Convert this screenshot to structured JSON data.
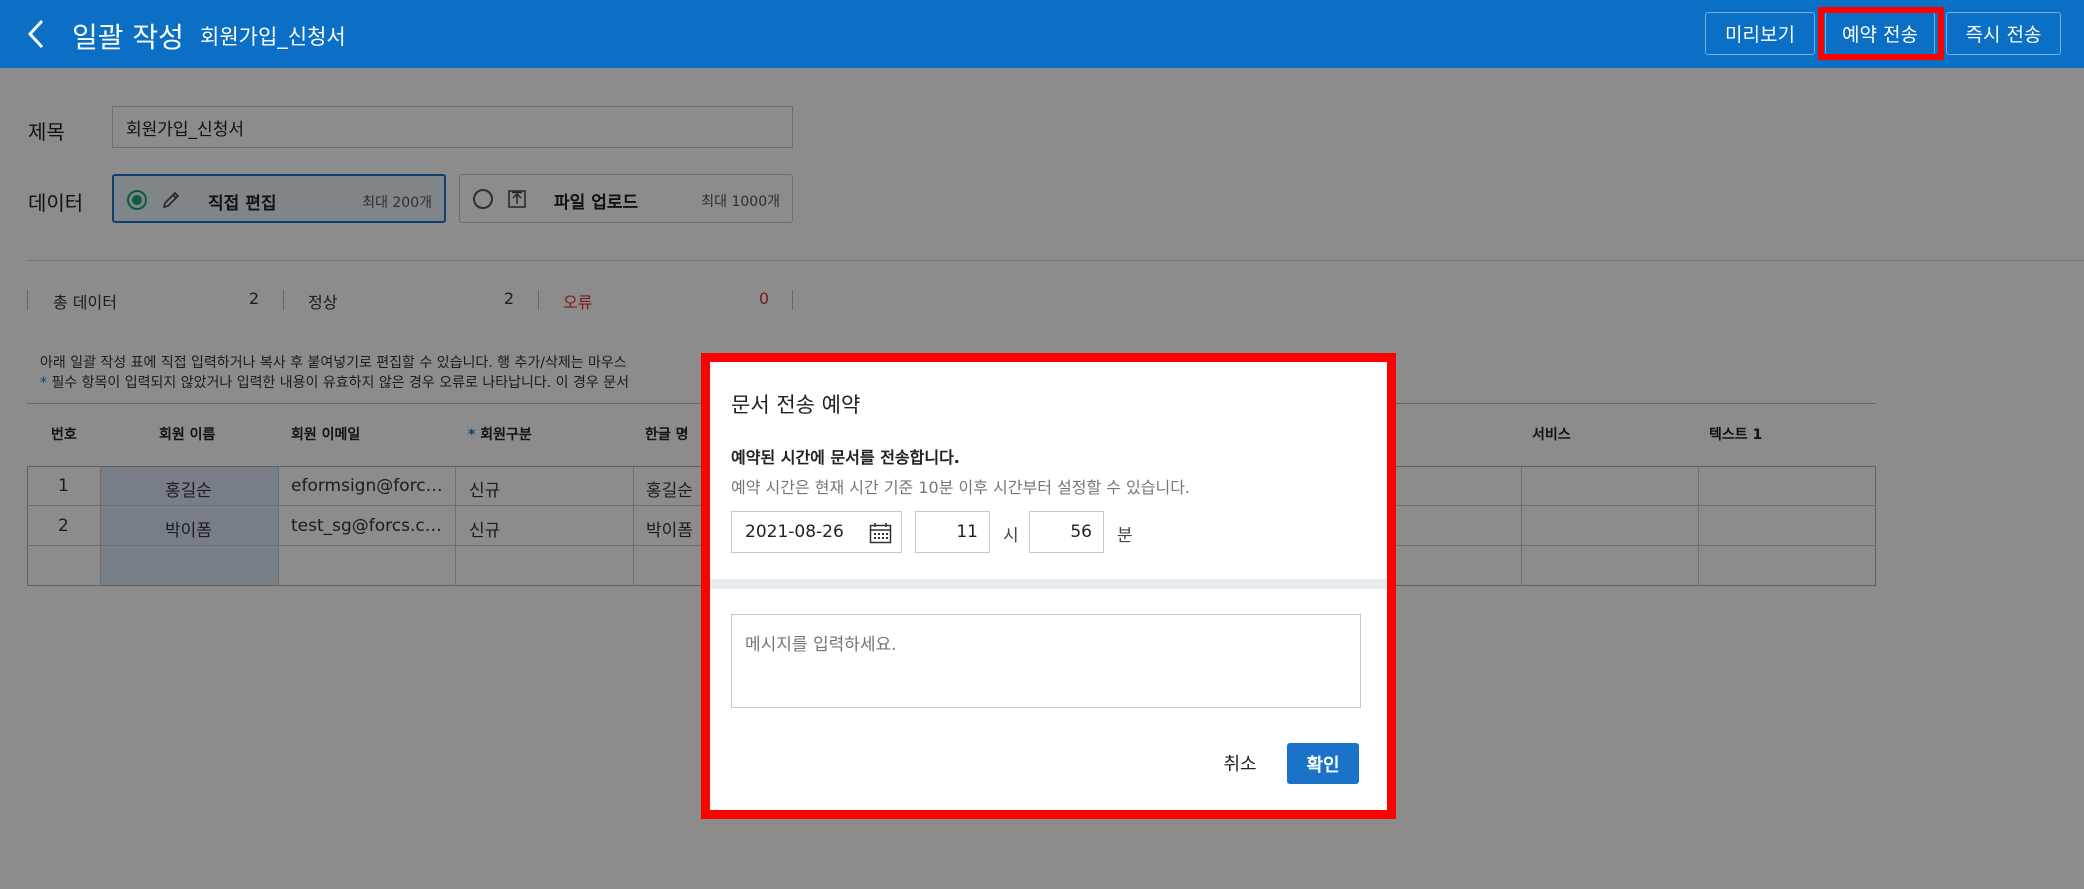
{
  "header": {
    "title": "일괄 작성",
    "subtitle": "회원가입_신청서",
    "preview_label": "미리보기",
    "reserve_label": "예약 전송",
    "instant_label": "즉시 전송"
  },
  "form": {
    "title_label": "제목",
    "title_value": "회원가입_신청서",
    "data_label": "데이터",
    "options": [
      {
        "label": "직접 편집",
        "limit": "최대 200개",
        "selected": true
      },
      {
        "label": "파일 업로드",
        "limit": "최대 1000개",
        "selected": false
      }
    ]
  },
  "stats": {
    "total_label": "총 데이터",
    "total_value": "2",
    "normal_label": "정상",
    "normal_value": "2",
    "error_label": "오류",
    "error_value": "0"
  },
  "notes": {
    "line1": "아래 일괄 작성 표에 직접 입력하거나 복사 후 붙여넣기로 편집할 수 있습니다. 행 추가/삭제는 마우스",
    "line2_star": "*",
    "line2": " 필수 항목이 입력되지 않았거나 입력한 내용이 유효하지 않은 경우 오류로 나타납니다. 이 경우 문서"
  },
  "table": {
    "headers": [
      "번호",
      "회원 이름",
      "회원 이메일",
      "회원구분",
      "한글 명",
      "서비스",
      "텍스트 1"
    ],
    "required_marker": "*",
    "rows": [
      [
        "1",
        "홍길순",
        "eformsign@forc…",
        "신규",
        "홍길순"
      ],
      [
        "2",
        "박이폼",
        "test_sg@forcs.c…",
        "신규",
        "박이폼"
      ]
    ]
  },
  "modal": {
    "title": "문서 전송 예약",
    "description": "예약된 시간에 문서를 전송합니다.",
    "sub_description": "예약 시간은 현재 시간 기준 10분 이후 시간부터 설정할 수 있습니다.",
    "date": "2021-08-26",
    "hour": "11",
    "hour_unit": "시",
    "minute": "56",
    "minute_unit": "분",
    "message_placeholder": "메시지를 입력하세요.",
    "cancel_label": "취소",
    "confirm_label": "확인"
  },
  "colors": {
    "header_bg": "#0b6fc6",
    "primary": "#1a73c8",
    "highlight": "#ff0000",
    "error": "#dd3333",
    "radio_selected": "#1aa37a"
  },
  "icons": [
    "chevron-left-icon",
    "pencil-icon",
    "upload-icon",
    "calendar-icon"
  ]
}
